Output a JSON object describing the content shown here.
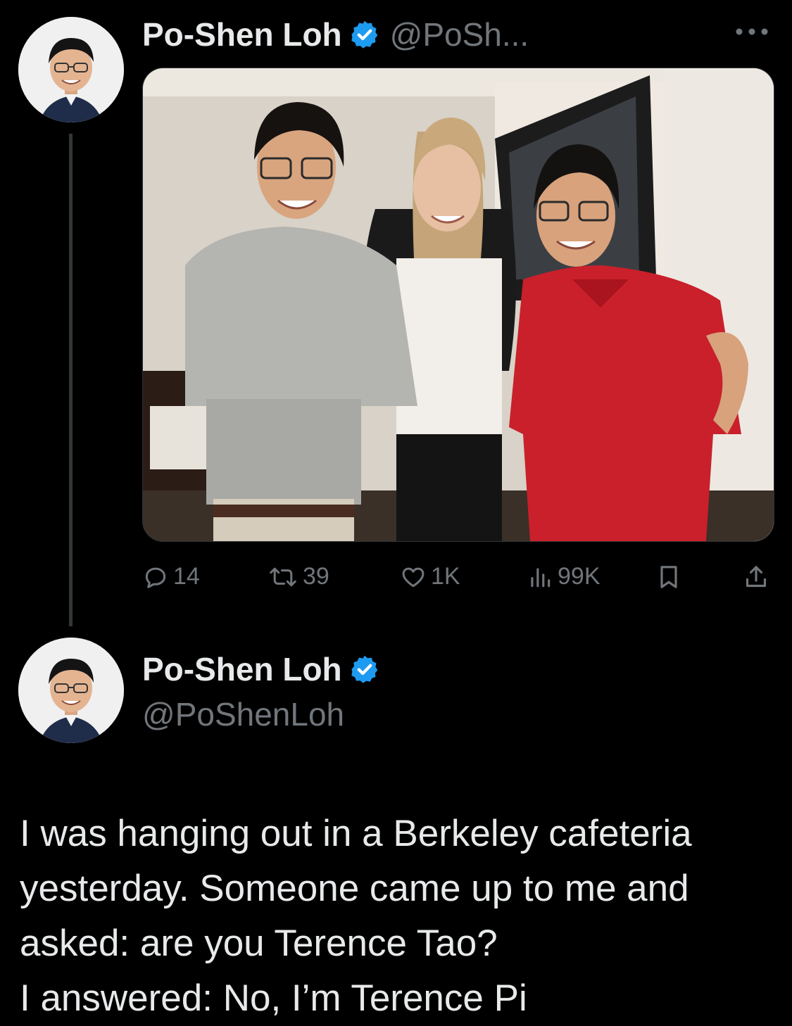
{
  "tweet1": {
    "display_name": "Po-Shen Loh",
    "handle": "@PoSh...",
    "image_alt": "Photo of three people smiling in a living room",
    "stats": {
      "replies": "14",
      "retweets": "39",
      "likes": "1K",
      "views": "99K"
    }
  },
  "tweet2": {
    "display_name": "Po-Shen Loh",
    "handle": "@PoShenLoh",
    "text_lines": [
      "I was hanging out in a Berkeley cafeteria",
      "yesterday. Someone came up to me and",
      "asked: are you Terence Tao?",
      "I answered: No, I’m Terence Pi"
    ]
  },
  "colors": {
    "background": "#000000",
    "text": "#e7e9ea",
    "secondary": "#71767b",
    "verified": "#1d9bf0"
  }
}
